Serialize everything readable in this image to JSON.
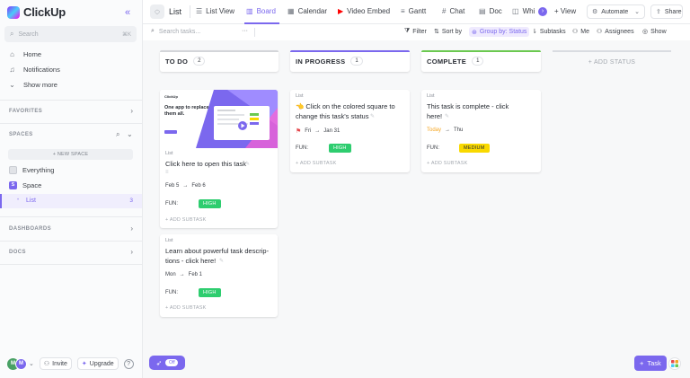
{
  "brand": {
    "name": "ClickUp"
  },
  "sidebar": {
    "search_placeholder": "Search",
    "search_shortcut": "⌘K",
    "nav": [
      {
        "label": "Home",
        "icon": "home-icon"
      },
      {
        "label": "Notifications",
        "icon": "bell-icon"
      },
      {
        "label": "Show more",
        "icon": "chevron-down-icon"
      }
    ],
    "favorites": "FAVORITES",
    "spaces": "SPACES",
    "new_space": "+ NEW SPACE",
    "everything": "Everything",
    "space": {
      "label": "Space",
      "letter": "S"
    },
    "list": {
      "label": "List",
      "count": "3"
    },
    "dashboards": "DASHBOARDS",
    "docs": "DOCS",
    "avatar1": "M",
    "avatar2": "M",
    "invite": "Invite",
    "upgrade": "Upgrade",
    "help": "?"
  },
  "topbar": {
    "title": "List",
    "tabs": [
      {
        "label": "List View",
        "icon": "list-icon"
      },
      {
        "label": "Board",
        "icon": "board-icon"
      },
      {
        "label": "Calendar",
        "icon": "calendar-icon"
      },
      {
        "label": "Video Embed",
        "icon": "youtube-icon"
      },
      {
        "label": "Gantt",
        "icon": "gantt-icon"
      },
      {
        "label": "Chat",
        "icon": "hash-icon"
      },
      {
        "label": "Doc",
        "icon": "doc-icon"
      },
      {
        "label": "Whi",
        "icon": "whiteboard-icon"
      }
    ],
    "add_view": "+ View",
    "automate": "Automate",
    "share": "Share"
  },
  "filterbar": {
    "search_placeholder": "Search tasks...",
    "more": "···",
    "filter": "Filter",
    "sort": "Sort by",
    "group": "Group by: Status",
    "subtasks": "Subtasks",
    "me": "Me",
    "assignees": "Assignees",
    "show": "Show"
  },
  "columns": [
    {
      "name": "TO DO",
      "count": "2",
      "color": "#d3d5d9"
    },
    {
      "name": "IN PROGRESS",
      "count": "1",
      "color": "#7b68ee"
    },
    {
      "name": "COMPLETE",
      "count": "1",
      "color": "#6bc950"
    }
  ],
  "add_status": "+ ADD STATUS",
  "cards": {
    "todo1": {
      "list": "List",
      "title": "Click here to open this task",
      "start": "Feb 5",
      "end": "Feb 6",
      "fun_label": "FUN:",
      "priority": "HIGH",
      "add_subtask": "+ ADD SUBTASK",
      "thumb_heading": "One app to replace them all.",
      "thumb_logo": "ClickUp"
    },
    "todo2": {
      "list": "List",
      "title_line1": "Learn about powerful task descrip-",
      "title_line2": "tions - click here!",
      "start": "Mon",
      "end": "Feb 1",
      "fun_label": "FUN:",
      "priority": "HIGH",
      "add_subtask": "+ ADD SUBTASK"
    },
    "progress1": {
      "list": "List",
      "title_line1": "👈 Click on the colored square to",
      "title_line2": "change this task's status",
      "start": "Fri",
      "end": "Jan 31",
      "fun_label": "FUN:",
      "priority": "HIGH",
      "add_subtask": "+ ADD SUBTASK"
    },
    "complete1": {
      "list": "List",
      "title_line1": "This task is complete - click",
      "title_line2": "here!",
      "start": "Today",
      "end": "Thu",
      "fun_label": "FUN:",
      "priority": "MEDIUM",
      "add_subtask": "+ ADD SUBTASK"
    }
  },
  "colors": {
    "accent": "#7b68ee",
    "high": "#2ecd6f",
    "medium": "#f9d900",
    "complete": "#6bc950"
  },
  "floating": {
    "toggle": "Off",
    "task": "Task"
  }
}
